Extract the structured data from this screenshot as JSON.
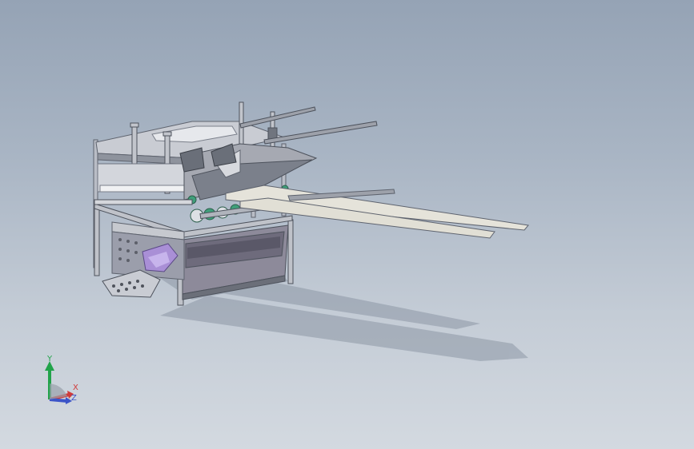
{
  "viewport": {
    "background_top": "#95a3b5",
    "background_bottom": "#d3d9e0"
  },
  "model": {
    "steel_color": "#b8bcc4",
    "dark_steel_color": "#6f7480",
    "accent_color": "#a98fd6",
    "gear_color": "#3f9f7a"
  },
  "triad": {
    "y_label": "Y",
    "x_label": "X",
    "z_label": "Z",
    "y_color": "#21a34a",
    "x_color": "#d03a3a",
    "z_color": "#3b54c8"
  }
}
